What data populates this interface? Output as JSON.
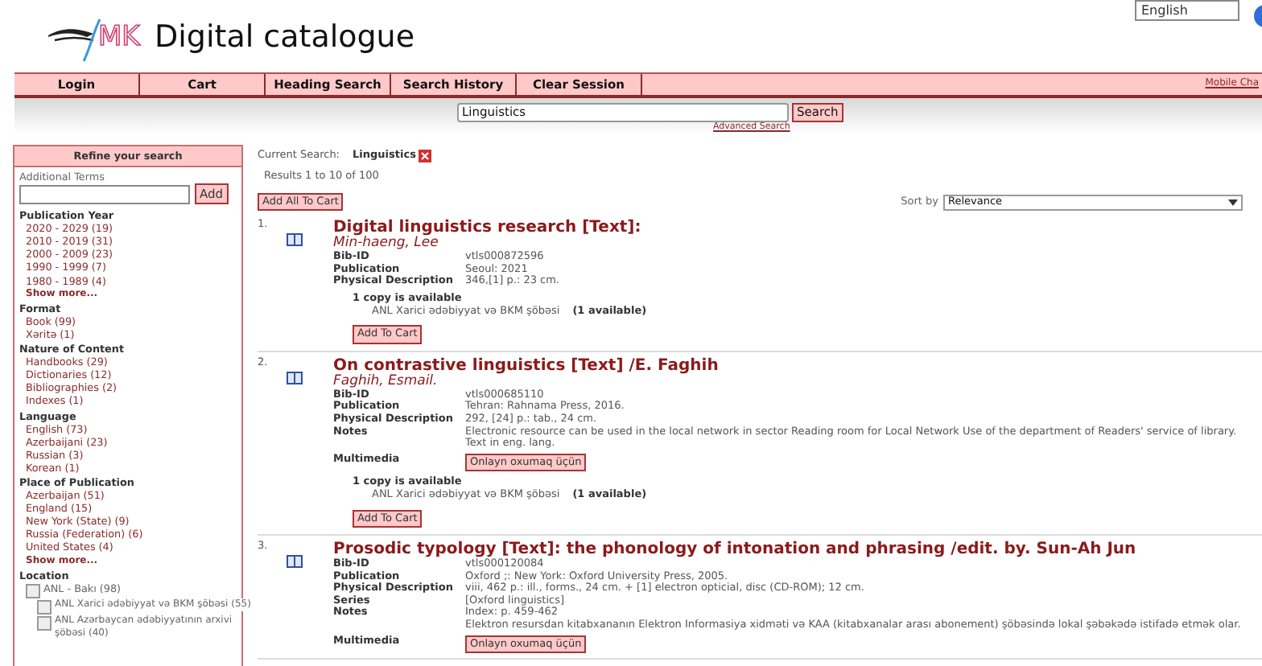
{
  "logo": {
    "text": "MK"
  },
  "title": "Digital catalogue",
  "language_select": {
    "value": "English"
  },
  "nav": [
    {
      "label": "Login"
    },
    {
      "label": "Cart"
    },
    {
      "label": "Heading Search"
    },
    {
      "label": "Search History"
    },
    {
      "label": "Clear Session"
    }
  ],
  "nav_link": "Mobile Cha",
  "search": {
    "value": "Linguistics",
    "button": "Search",
    "advanced_link": "Advanced Search"
  },
  "sidebar": {
    "title": "Refine your search",
    "terms_label": "Additional Terms",
    "add_button": "Add",
    "groups": [
      {
        "heading": "Publication Year",
        "items": [
          {
            "kind": "link",
            "label": "2020 - 2029 (19)"
          },
          {
            "kind": "link",
            "label": "2010 - 2019 (31)"
          },
          {
            "kind": "link",
            "label": "2000 - 2009 (23)"
          },
          {
            "kind": "link",
            "label": "1990 - 1999 (7)"
          },
          {
            "kind": "link",
            "label": "1980 - 1989 (4)"
          }
        ],
        "show_more": "Show more..."
      },
      {
        "heading": "Format",
        "items": [
          {
            "kind": "link",
            "label": "Book (99)"
          },
          {
            "kind": "link",
            "label": "Xəritə (1)"
          }
        ]
      },
      {
        "heading": "Nature of Content",
        "items": [
          {
            "kind": "link",
            "label": "Handbooks (29)"
          },
          {
            "kind": "link",
            "label": "Dictionaries (12)"
          },
          {
            "kind": "link",
            "label": "Bibliographies (2)"
          },
          {
            "kind": "link",
            "label": "Indexes (1)"
          }
        ]
      },
      {
        "heading": "Language",
        "items": [
          {
            "kind": "link",
            "label": "English (73)"
          },
          {
            "kind": "link",
            "label": "Azerbaijani (23)"
          },
          {
            "kind": "link",
            "label": "Russian (3)"
          },
          {
            "kind": "link",
            "label": "Korean (1)"
          }
        ]
      },
      {
        "heading": "Place of Publication",
        "items": [
          {
            "kind": "link",
            "label": "Azerbaijan (51)"
          },
          {
            "kind": "link",
            "label": "England (15)"
          },
          {
            "kind": "link",
            "label": "New York (State) (9)"
          },
          {
            "kind": "link",
            "label": "Russia (Federation) (6)"
          },
          {
            "kind": "link",
            "label": "United States (4)"
          }
        ],
        "show_more": "Show more..."
      },
      {
        "heading": "Location",
        "items": [
          {
            "kind": "checkbox",
            "label": "ANL - Bakı (98)",
            "checked": false,
            "children": [
              {
                "kind": "checkbox",
                "label": "ANL Xarici ədəbiyyat və BKM şöbəsi (55)",
                "checked": false
              },
              {
                "kind": "checkbox",
                "label": "ANL Azərbaycan ədəbiyyatının arxivi şöbəsi (40)",
                "checked": false
              }
            ]
          }
        ]
      }
    ]
  },
  "current_search": {
    "label": "Current Search:",
    "term": "Linguistics"
  },
  "results_summary": "Results 1 to 10 of 100",
  "sort": {
    "label": "Sort by",
    "value": "Relevance"
  },
  "add_all_button": "Add All To Cart",
  "results": [
    {
      "number": "1.",
      "title": "Digital linguistics research [Text]:",
      "author": "Min-haeng, Lee",
      "fields": [
        {
          "label": "Bib-ID",
          "lines": [
            "vtls000872596"
          ]
        },
        {
          "label": "Publication",
          "lines": [
            "Seoul: 2021"
          ]
        },
        {
          "label": "Physical Description",
          "lines": [
            "346,[1] p.: 23 cm."
          ]
        }
      ],
      "availability": {
        "heading": "1 copy is available",
        "location": "ANL Xarici ədəbiyyat və BKM şöbəsi",
        "count": "(1 available)"
      },
      "add_button": "Add To Cart"
    },
    {
      "number": "2.",
      "title": "On contrastive linguistics [Text] /E. Faghih",
      "author": "Faghih, Esmail.",
      "fields": [
        {
          "label": "Bib-ID",
          "lines": [
            "vtls000685110"
          ]
        },
        {
          "label": "Publication",
          "lines": [
            "Tehran: Rahnama Press, 2016."
          ]
        },
        {
          "label": "Physical Description",
          "lines": [
            "292, [24] p.: tab., 24 cm."
          ]
        },
        {
          "label": "Notes",
          "lines": [
            "Electronic resource can be used in the local network in sector Reading room for Local Network Use of the department of Readers' service of library.",
            "Text in eng. lang."
          ]
        }
      ],
      "multimedia": {
        "label": "Multimedia",
        "button": "Onlayn oxumaq üçün"
      },
      "availability": {
        "heading": "1 copy is available",
        "location": "ANL Xarici ədəbiyyat və BKM şöbəsi",
        "count": "(1 available)"
      },
      "add_button": "Add To Cart"
    },
    {
      "number": "3.",
      "title": "Prosodic typology [Text]: the phonology of intonation and phrasing /edit. by. Sun-Ah Jun",
      "fields": [
        {
          "label": "Bib-ID",
          "lines": [
            "vtls000120084"
          ]
        },
        {
          "label": "Publication",
          "lines": [
            "Oxford ;: New York: Oxford University Press, 2005."
          ]
        },
        {
          "label": "Physical Description",
          "lines": [
            "viii, 462 p.: ill., forms., 24 cm. + [1] electron opticial, disc (CD-ROM); 12 cm."
          ]
        },
        {
          "label": "Series",
          "lines": [
            "[Oxford linguistics]"
          ]
        },
        {
          "label": "Notes",
          "lines": [
            "Index: p. 459-462",
            "Elektron resursdan kitabxananın Elektron Informasiya xidməti və KAA (kitabxanalar arası abonement) şöbəsində lokal şəbəkədə istifadə etmək olar."
          ]
        }
      ],
      "multimedia": {
        "label": "Multimedia",
        "button": "Onlayn oxumaq üçün"
      }
    }
  ]
}
